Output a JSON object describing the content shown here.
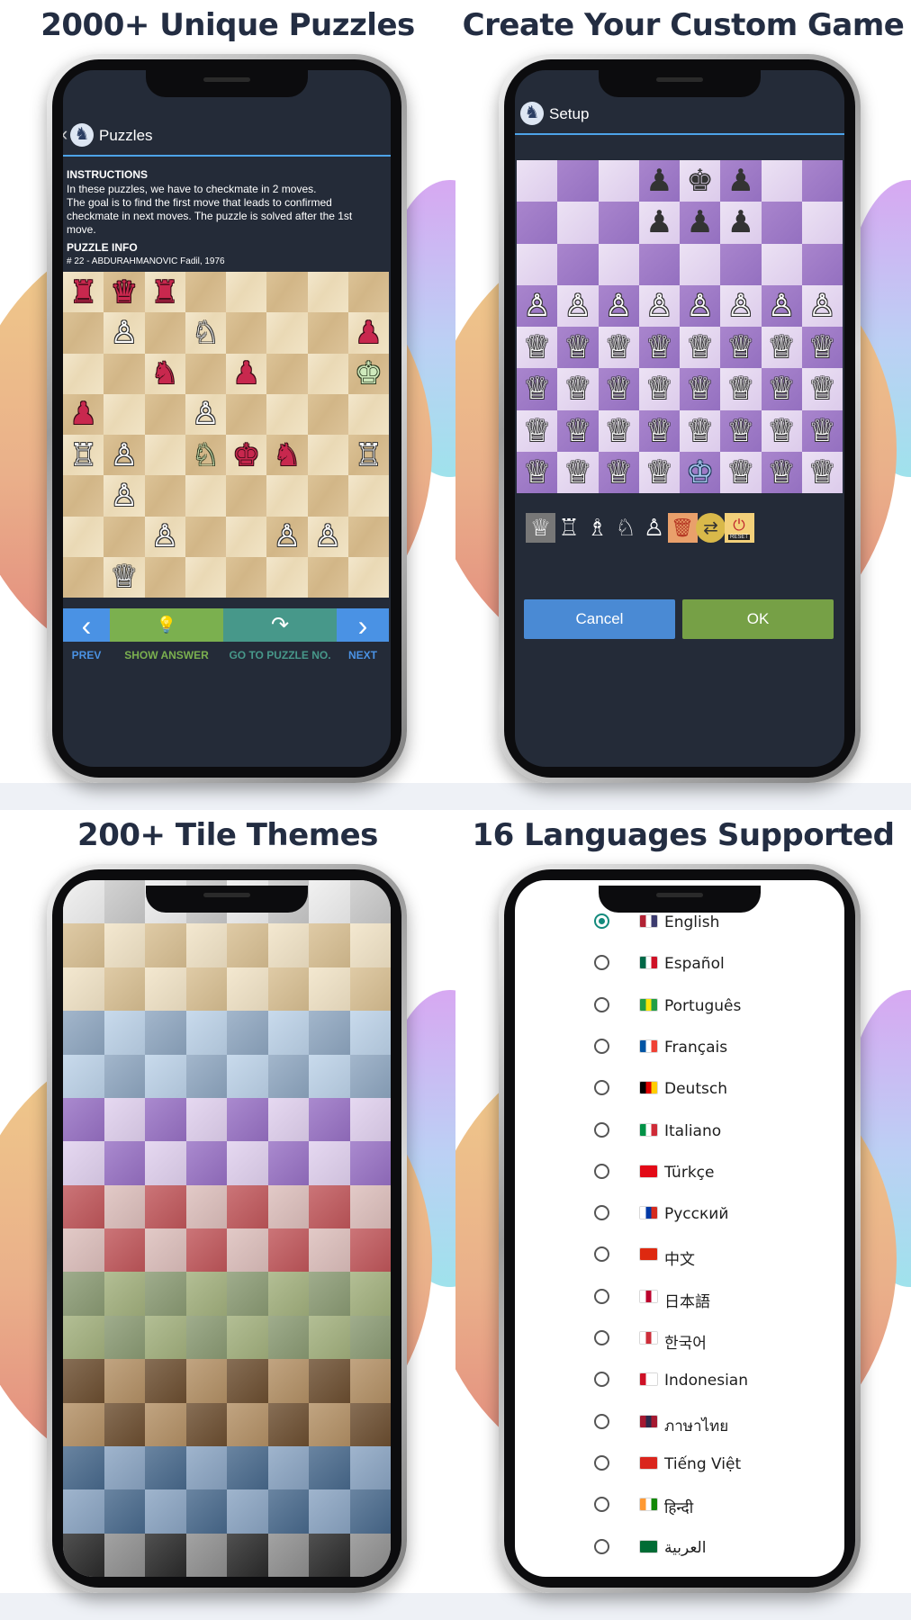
{
  "panels": {
    "puzzles": {
      "title": "2000+ Unique Puzzles"
    },
    "custom": {
      "title": "Create Your Custom Game"
    },
    "themes": {
      "title": "200+ Tile Themes"
    },
    "languages": {
      "title": "16 Languages Supported"
    }
  },
  "puzzle_screen": {
    "back_glyph": "‹",
    "logo_glyph": "♞",
    "header_title": "Puzzles",
    "instructions_heading": "INSTRUCTIONS",
    "instructions_line1": "In these puzzles, we have to checkmate in 2 moves.",
    "instructions_line2": "The goal is to find the first move that leads to confirmed checkmate in next moves. The puzzle is solved after the 1st move.",
    "info_heading": "PUZZLE INFO",
    "info_text": "# 22 - ABDURAHMANOVIC Fadil, 1976",
    "board": [
      [
        "r♜",
        "r♛",
        "r♜",
        "",
        "",
        "",
        "",
        ""
      ],
      [
        "",
        "w♙",
        "",
        "w♘",
        "",
        "",
        "",
        "r♟"
      ],
      [
        "",
        "",
        "r♞",
        "",
        "r♟",
        "",
        "",
        "g♚"
      ],
      [
        "r♟",
        "",
        "",
        "w♙",
        "",
        "",
        "",
        ""
      ],
      [
        "w♖",
        "w♙",
        "",
        "g♘",
        "r♚",
        "r♞",
        "",
        "w♖"
      ],
      [
        "",
        "w♙",
        "",
        "",
        "",
        "",
        "",
        ""
      ],
      [
        "",
        "",
        "w♙",
        "",
        "",
        "w♙",
        "w♙",
        ""
      ],
      [
        "",
        "w♕",
        "",
        "",
        "",
        "",
        "",
        ""
      ]
    ],
    "controls": {
      "prev_icon": "‹",
      "prev_label": "PREV",
      "answer_icon": "💡",
      "answer_label": "SHOW ANSWER",
      "goto_icon": "↷",
      "goto_label": "GO TO PUZZLE NO.",
      "next_icon": "›",
      "next_label": "NEXT"
    },
    "colors": {
      "prev": "#4a92e4",
      "answer": "#7bb04f",
      "goto": "#47988a",
      "next": "#4a92e4"
    }
  },
  "setup_screen": {
    "logo_glyph": "♞",
    "header_title": "Setup",
    "board": [
      [
        "",
        "",
        "",
        "k♟",
        "k♚",
        "k♟",
        "",
        ""
      ],
      [
        "",
        "",
        "",
        "k♟",
        "k♟",
        "k♟",
        "",
        ""
      ],
      [
        "",
        "",
        "",
        "",
        "",
        "",
        "",
        ""
      ],
      [
        "w♙",
        "w♙",
        "w♙",
        "w♙",
        "w♙",
        "w♙",
        "w♙",
        "w♙"
      ],
      [
        "w♕",
        "w♕",
        "w♕",
        "w♕",
        "w♕",
        "w♕",
        "w♕",
        "w♕"
      ],
      [
        "w♕",
        "w♕",
        "w♕",
        "w♕",
        "w♕",
        "w♕",
        "w♕",
        "w♕"
      ],
      [
        "w♕",
        "w♕",
        "w♕",
        "w♕",
        "w♕",
        "w♕",
        "w♕",
        "w♕"
      ],
      [
        "w♕",
        "w♕",
        "w♕",
        "w♕",
        "b♔",
        "w♕",
        "w♕",
        "w♕"
      ]
    ],
    "tray": [
      {
        "name": "queen-tool-icon",
        "glyph": "♕"
      },
      {
        "name": "rook-tool-icon",
        "glyph": "♖"
      },
      {
        "name": "bishop-tool-icon",
        "glyph": "♗"
      },
      {
        "name": "knight-tool-icon",
        "glyph": "♘"
      },
      {
        "name": "pawn-tool-icon",
        "glyph": "♙"
      },
      {
        "name": "trash-icon",
        "glyph": "🗑"
      },
      {
        "name": "swap-color-icon",
        "glyph": "⇄"
      },
      {
        "name": "reset-icon",
        "glyph": "⏻"
      }
    ],
    "reset_label": "RESET",
    "cancel_label": "Cancel",
    "ok_label": "OK",
    "colors": {
      "cancel": "#4a8ad4",
      "ok": "#76a046"
    }
  },
  "themes_screen": {
    "rows": [
      {
        "light": "#eeeeee",
        "dark": "#c9c9c9"
      },
      {
        "light": "#f1e3c6",
        "dark": "#d8bf92"
      },
      {
        "light": "#f1e3c6",
        "dark": "#d8bf92"
      },
      {
        "light": "#bcd2e8",
        "dark": "#8ea6c0"
      },
      {
        "light": "#bcd2e8",
        "dark": "#8ea6c0"
      },
      {
        "light": "#e0d0ee",
        "dark": "#9770c4"
      },
      {
        "light": "#e0d0ee",
        "dark": "#9770c4"
      },
      {
        "light": "#dcbebb",
        "dark": "#c0565a"
      },
      {
        "light": "#dcbebb",
        "dark": "#c0565a"
      },
      {
        "light": "#a2b07d",
        "dark": "#8a9a73"
      },
      {
        "light": "#a2b07d",
        "dark": "#8a9a73"
      },
      {
        "light": "#b39065",
        "dark": "#6c4e30"
      },
      {
        "light": "#b39065",
        "dark": "#6c4e30"
      },
      {
        "light": "#8aa4c2",
        "dark": "#48698c"
      },
      {
        "light": "#8aa4c2",
        "dark": "#48698c"
      },
      {
        "light": "#8e8e8e",
        "dark": "#2a2a2a"
      }
    ]
  },
  "languages_screen": {
    "items": [
      {
        "label": "English",
        "flag": [
          "#b22234",
          "#ffffff",
          "#3c3b6e"
        ],
        "selected": true
      },
      {
        "label": "Español",
        "flag": [
          "#006847",
          "#ffffff",
          "#ce1126"
        ],
        "selected": false
      },
      {
        "label": "Português",
        "flag": [
          "#229e45",
          "#f8e509",
          "#229e45"
        ],
        "selected": false
      },
      {
        "label": "Français",
        "flag": [
          "#0055a4",
          "#ffffff",
          "#ef4135"
        ],
        "selected": false
      },
      {
        "label": "Deutsch",
        "flag": [
          "#000000",
          "#dd0000",
          "#ffce00"
        ],
        "selected": false
      },
      {
        "label": "Italiano",
        "flag": [
          "#009246",
          "#ffffff",
          "#ce2b37"
        ],
        "selected": false
      },
      {
        "label": "Türkçe",
        "flag": [
          "#e30a17",
          "#e30a17",
          "#e30a17"
        ],
        "selected": false
      },
      {
        "label": "Русский",
        "flag": [
          "#ffffff",
          "#0039a6",
          "#d52b1e"
        ],
        "selected": false
      },
      {
        "label": "中文",
        "flag": [
          "#de2910",
          "#de2910",
          "#de2910"
        ],
        "selected": false
      },
      {
        "label": "日本語",
        "flag": [
          "#ffffff",
          "#bc002d",
          "#ffffff"
        ],
        "selected": false
      },
      {
        "label": "한국어",
        "flag": [
          "#ffffff",
          "#cd2e3a",
          "#ffffff"
        ],
        "selected": false
      },
      {
        "label": "Indonesian",
        "flag": [
          "#ce1126",
          "#ffffff",
          "#ffffff"
        ],
        "selected": false
      },
      {
        "label": "ภาษาไทย",
        "flag": [
          "#a51931",
          "#2d2a4a",
          "#a51931"
        ],
        "selected": false
      },
      {
        "label": "Tiếng Việt",
        "flag": [
          "#da251d",
          "#da251d",
          "#da251d"
        ],
        "selected": false
      },
      {
        "label": "हिन्दी",
        "flag": [
          "#ff9933",
          "#ffffff",
          "#138808"
        ],
        "selected": false
      },
      {
        "label": "العربية",
        "flag": [
          "#006c35",
          "#006c35",
          "#006c35"
        ],
        "selected": false
      }
    ],
    "selected_color": "#138a7c"
  }
}
